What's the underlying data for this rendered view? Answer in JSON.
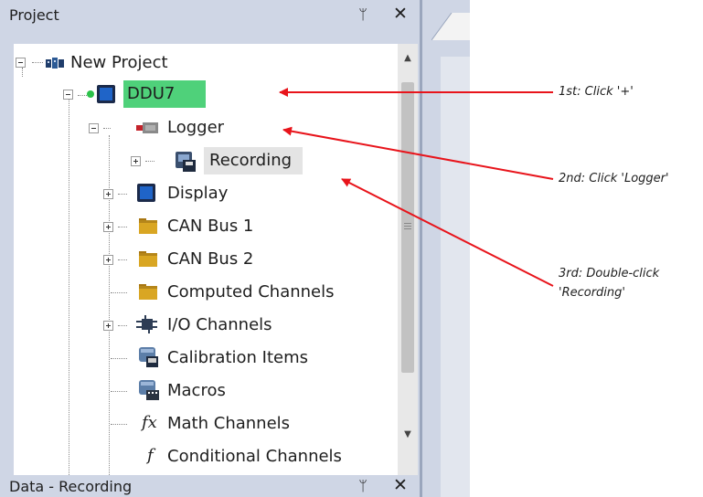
{
  "project_panel": {
    "title": "Project",
    "pin_glyph": "ᛘ",
    "close_glyph": "✕",
    "tree": [
      {
        "label": "New Project",
        "icon": "project-icon"
      },
      {
        "label": "DDU7",
        "icon": "device-icon",
        "selected": true
      },
      {
        "label": "Logger",
        "icon": "logger-icon"
      },
      {
        "label": "Recording",
        "icon": "recording-icon",
        "highlighted": true
      },
      {
        "label": "Display",
        "icon": "display-icon"
      },
      {
        "label": "CAN Bus 1",
        "icon": "folder-icon"
      },
      {
        "label": "CAN Bus 2",
        "icon": "folder-icon"
      },
      {
        "label": "Computed Channels",
        "icon": "folder-icon"
      },
      {
        "label": "I/O Channels",
        "icon": "io-channels-icon"
      },
      {
        "label": "Calibration Items",
        "icon": "calibration-icon"
      },
      {
        "label": "Macros",
        "icon": "macros-icon"
      },
      {
        "label": "Math Channels",
        "icon": "fx-icon",
        "icon_text": "fx"
      },
      {
        "label": "Conditional Channels",
        "icon": "fx-icon",
        "icon_text": "f"
      }
    ]
  },
  "data_panel": {
    "title": "Data - Recording",
    "pin_glyph": "ᛘ",
    "close_glyph": "✕"
  },
  "annotations": {
    "step1": "1st: Click '+'",
    "step2": "2nd: Click 'Logger'",
    "step3_line1": "3rd: Double-click",
    "step3_line2": "'Recording'"
  },
  "colors": {
    "panel_bg": "#cfd6e5",
    "selected_bg": "#4fd17a",
    "arrow": "#e8141b",
    "folder": "#d9a623"
  }
}
